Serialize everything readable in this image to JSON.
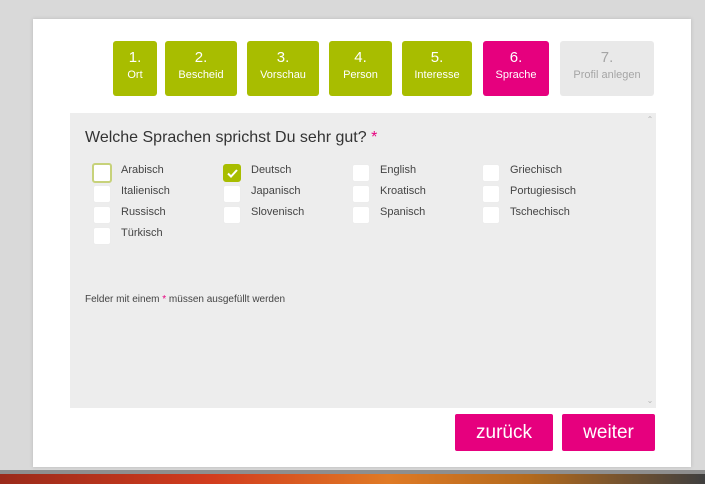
{
  "steps": [
    {
      "num": "1.",
      "label": "Ort",
      "state": "done"
    },
    {
      "num": "2.",
      "label": "Bescheid",
      "state": "done"
    },
    {
      "num": "3.",
      "label": "Vorschau",
      "state": "done"
    },
    {
      "num": "4.",
      "label": "Person",
      "state": "done"
    },
    {
      "num": "5.",
      "label": "Interesse",
      "state": "done"
    },
    {
      "num": "6.",
      "label": "Sprache",
      "state": "active"
    },
    {
      "num": "7.",
      "label": "Profil anlegen",
      "state": "todo"
    }
  ],
  "question": {
    "text": "Welche Sprachen sprichst Du sehr gut?",
    "required_mark": "*"
  },
  "languages": [
    {
      "label": "Arabisch",
      "checked": false
    },
    {
      "label": "Deutsch",
      "checked": true
    },
    {
      "label": "English",
      "checked": false
    },
    {
      "label": "Griechisch",
      "checked": false
    },
    {
      "label": "Italienisch",
      "checked": false
    },
    {
      "label": "Japanisch",
      "checked": false
    },
    {
      "label": "Kroatisch",
      "checked": false
    },
    {
      "label": "Portugiesisch",
      "checked": false
    },
    {
      "label": "Russisch",
      "checked": false
    },
    {
      "label": "Slovenisch",
      "checked": false
    },
    {
      "label": "Spanisch",
      "checked": false
    },
    {
      "label": "Tschechisch",
      "checked": false
    },
    {
      "label": "Türkisch",
      "checked": false
    }
  ],
  "note": {
    "before": "Felder mit einem ",
    "mark": "*",
    "after": " müssen ausgefüllt werden"
  },
  "buttons": {
    "back": "zurück",
    "next": "weiter"
  },
  "colors": {
    "done": "#a8bd00",
    "active": "#e6007e",
    "todo": "#e9e9e9",
    "required": "#e6007e"
  }
}
